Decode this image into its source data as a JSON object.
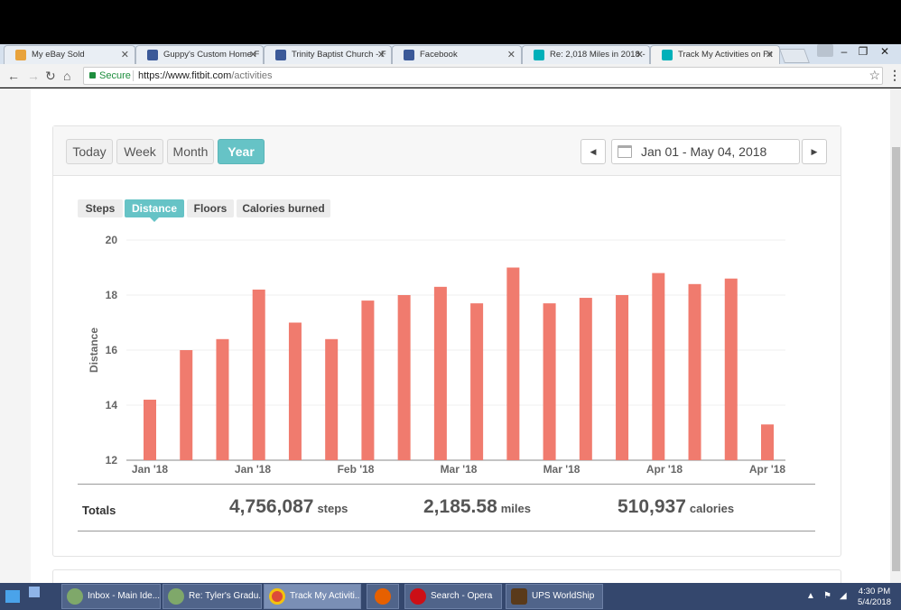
{
  "browser": {
    "tabs": [
      {
        "title": "My eBay Sold",
        "icon": "ebay-favicon",
        "active": false
      },
      {
        "title": "Guppy's Custom Home F",
        "icon": "facebook-favicon",
        "active": false
      },
      {
        "title": "Trinity Baptist Church - F",
        "icon": "facebook-favicon",
        "active": false
      },
      {
        "title": "Facebook",
        "icon": "facebook-favicon",
        "active": false
      },
      {
        "title": "Re: 2,018 Miles in 2018 -",
        "icon": "fitbit-favicon",
        "active": false
      },
      {
        "title": "Track My Activities on Fit",
        "icon": "fitbit-favicon",
        "active": true
      }
    ],
    "security_label": "Secure",
    "url_host": "https://www.fitbit.com",
    "url_path": "/activities"
  },
  "activities": {
    "range_buttons": [
      "Today",
      "Week",
      "Month",
      "Year"
    ],
    "active_range": "Year",
    "date_range": "Jan 01 - May 04, 2018",
    "metric_tabs": [
      "Steps",
      "Distance",
      "Floors",
      "Calories burned"
    ],
    "active_metric": "Distance",
    "totals": {
      "label": "Totals",
      "steps_value": "4,756,087",
      "steps_unit": "steps",
      "miles_value": "2,185.58",
      "miles_unit": "miles",
      "calories_value": "510,937",
      "calories_unit": "calories"
    }
  },
  "chart_data": {
    "type": "bar",
    "ylabel": "Distance",
    "xlabel": "",
    "ylim": [
      12,
      20
    ],
    "yticks": [
      12,
      14,
      16,
      18,
      20
    ],
    "bar_color": "#f07b6e",
    "x_tick_labels": [
      "Jan '18",
      "Jan '18",
      "Feb '18",
      "Mar '18",
      "Mar '18",
      "Apr '18",
      "Apr '18"
    ],
    "values": [
      14.2,
      16.0,
      16.4,
      18.2,
      17.0,
      16.4,
      17.8,
      18.0,
      18.3,
      17.7,
      19.0,
      17.7,
      17.9,
      18.0,
      18.8,
      18.4,
      18.6,
      13.3
    ],
    "grid": true
  },
  "taskbar": {
    "items": [
      {
        "label": "Inbox - Main Ide...",
        "icon": "mail-app-icon",
        "active": false
      },
      {
        "label": "Re: Tyler's Gradu...",
        "icon": "mail-app-icon",
        "active": false
      },
      {
        "label": "Track My Activiti...",
        "icon": "chrome-icon",
        "active": true
      },
      {
        "label": "",
        "icon": "firefox-icon",
        "active": false
      },
      {
        "label": "Search - Opera",
        "icon": "opera-icon",
        "active": false
      },
      {
        "label": "UPS WorldShip",
        "icon": "ups-icon",
        "active": false
      }
    ],
    "clock_time": "4:30 PM",
    "clock_date": "5/4/2018"
  }
}
